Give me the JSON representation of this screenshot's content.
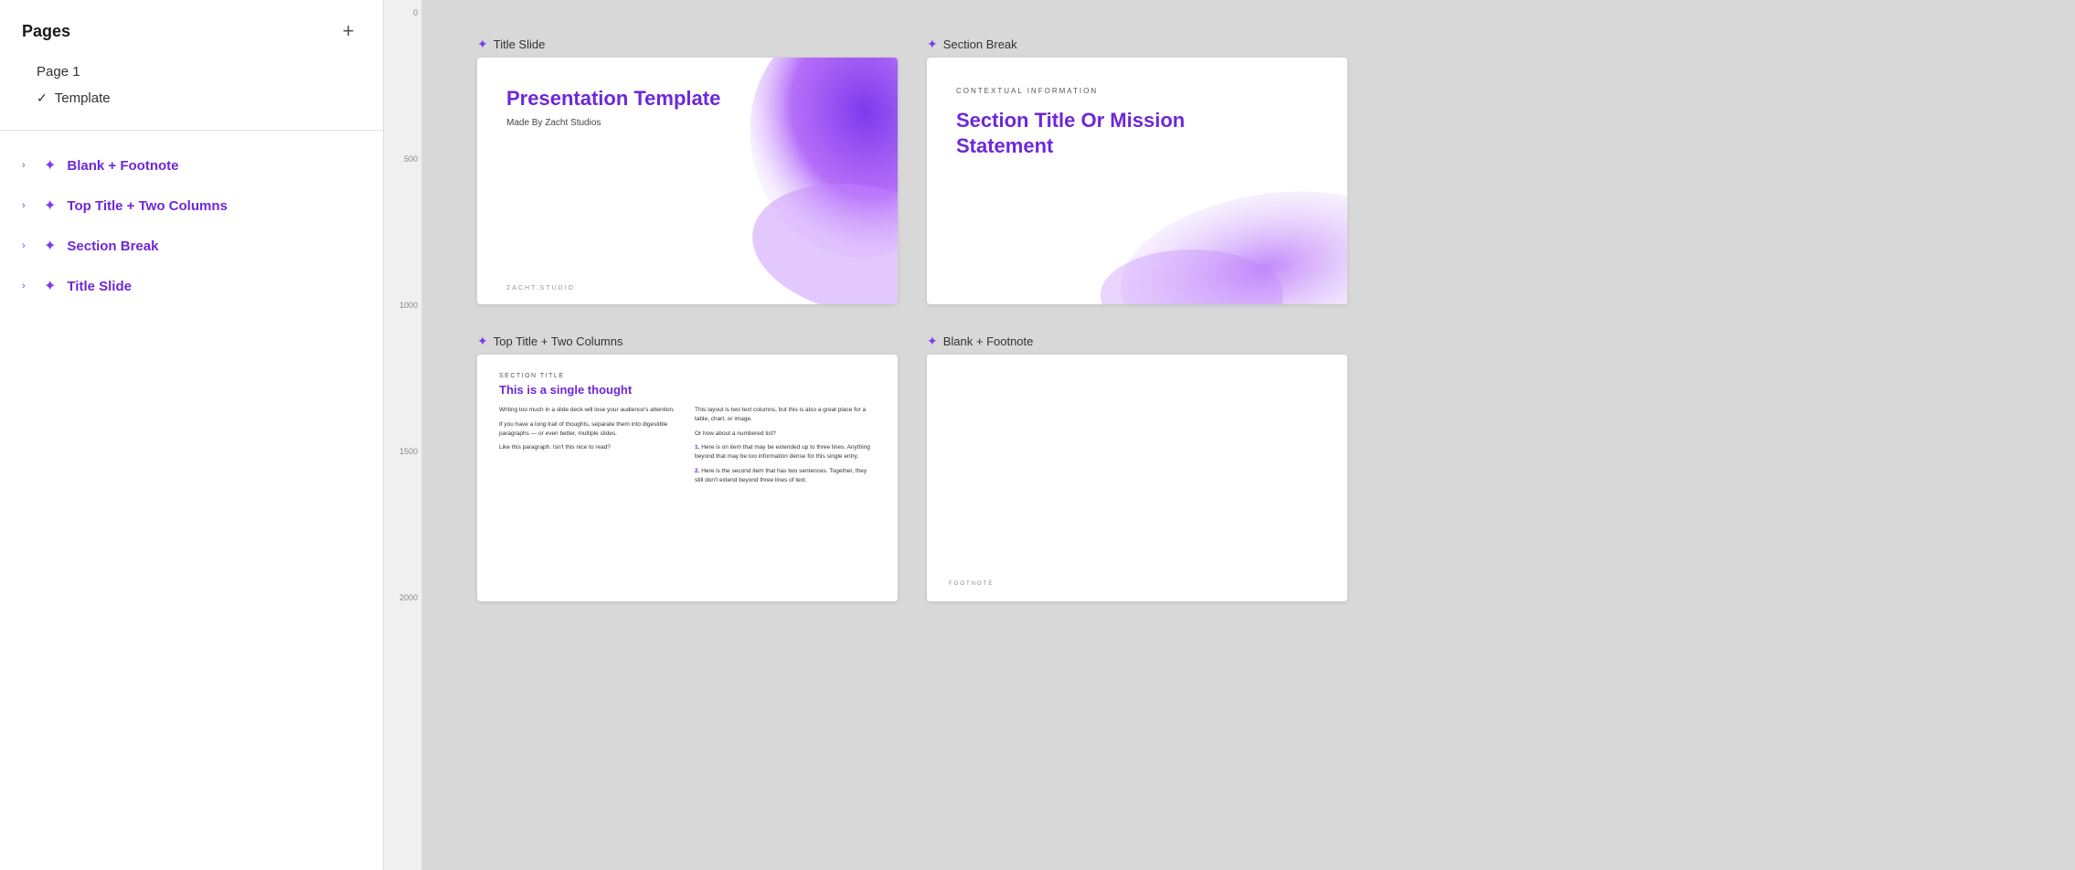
{
  "sidebar": {
    "header": {
      "title": "Pages",
      "add_button_label": "+"
    },
    "pages": [
      {
        "id": "page1",
        "label": "Page 1",
        "active": false
      },
      {
        "id": "template",
        "label": "Template",
        "active": true
      }
    ],
    "layouts": [
      {
        "id": "blank-footnote",
        "label": "Blank + Footnote"
      },
      {
        "id": "top-title-two-columns",
        "label": "Top Title + Two Columns"
      },
      {
        "id": "section-break",
        "label": "Section Break"
      },
      {
        "id": "title-slide",
        "label": "Title Slide"
      }
    ]
  },
  "canvas": {
    "slides": [
      {
        "id": "title-slide",
        "label": "Title Slide",
        "type": "title",
        "content": {
          "title": "Presentation Template",
          "subtitle": "Made By Zacht Studios",
          "brand": "ZACHT.STUDIO"
        }
      },
      {
        "id": "section-break",
        "label": "Section Break",
        "type": "section-break",
        "content": {
          "contextual": "CONTEXTUAL INFORMATION",
          "title": "Section Title Or Mission Statement"
        }
      },
      {
        "id": "top-title-two-columns",
        "label": "Top Title + Two Columns",
        "type": "two-columns",
        "content": {
          "section_title": "Section Title",
          "main_title": "This is a single thought",
          "col1": [
            "Writing too much in a slide deck will lose your audience's attention.",
            "If you have a long trail of thoughts, separate them into digestible paragraphs — or even better, multiple slides.",
            "Like this paragraph. Isn't this nice to read?"
          ],
          "col2_intro": "This layout is two text columns, but this is also a great place for a table, chart, or image.",
          "col2_question": "Or how about a numbered list?",
          "col2_items": [
            {
              "num": "1.",
              "text": "Here is on item that may be extended up to three lines. Anything beyond that may be too information dense for this single entry."
            },
            {
              "num": "2.",
              "text": "Here is the second item that has two sentences. Together, they still don't extend beyond three lines of text."
            }
          ]
        }
      },
      {
        "id": "blank-footnote",
        "label": "Blank + Footnote",
        "type": "blank-footnote",
        "content": {
          "footnote": "FOOTNOTE"
        }
      }
    ]
  },
  "ruler": {
    "ticks": [
      0,
      500,
      1000,
      1500,
      2000
    ]
  },
  "colors": {
    "purple_accent": "#6d28d9",
    "purple_light": "#a855f7",
    "purple_lighter": "#e9d5ff"
  },
  "icons": {
    "sparkle": "✦",
    "checkmark": "✓",
    "chevron_right": "›"
  }
}
